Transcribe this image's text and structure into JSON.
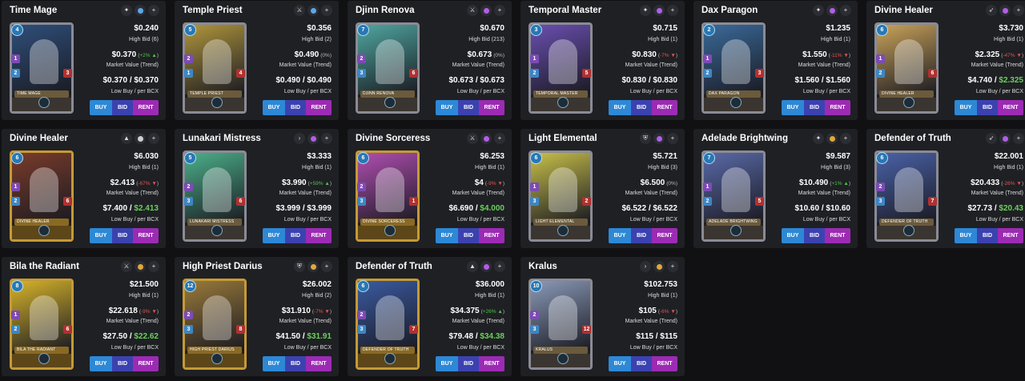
{
  "labels": {
    "high_bid_prefix": "High Bid",
    "market_value": "Market Value (Trend)",
    "low_buy": "Low Buy / per BCX",
    "buy": "BUY",
    "bid": "BID",
    "rent": "RENT"
  },
  "colors": {
    "buy": "#2d88d6",
    "bid": "#3b42b0",
    "rent": "#9c2bb3",
    "positive": "#4fc24a",
    "negative": "#e0554e",
    "silver_frame": "#8b8b95",
    "gold_frame": "#c59a36"
  },
  "cards": [
    {
      "name": "Time Mage",
      "type_icon": "summoner-hex-icon",
      "rarity_color": "#5aa8e6",
      "foil": "regular",
      "element_color": "#2f4f7a",
      "mana": "4",
      "atk": "1",
      "spd": "2",
      "hp": "3",
      "price": "$0.240",
      "high_bid": "High Bid (6)",
      "mv": "$0.370",
      "trend": "+2%",
      "trend_dir": "pos",
      "trend_arrow": "▲",
      "low_buy": "$0.370",
      "low_bcx": "$0.370",
      "bcx_green": false,
      "banner": "TIME MAGE"
    },
    {
      "name": "Temple Priest",
      "type_icon": "sword-icon",
      "rarity_color": "#5aa8e6",
      "foil": "regular",
      "element_color": "#b0963c",
      "mana": "5",
      "atk": "2",
      "spd": "1",
      "hp": "4",
      "price": "$0.356",
      "high_bid": "High Bid (2)",
      "mv": "$0.490",
      "trend": "0%",
      "trend_dir": "neu",
      "trend_arrow": "",
      "low_buy": "$0.490",
      "low_bcx": "$0.490",
      "bcx_green": false,
      "banner": "TEMPLE PRIEST"
    },
    {
      "name": "Djinn Renova",
      "type_icon": "sword-icon",
      "rarity_color": "#b05ee6",
      "foil": "regular",
      "element_color": "#4fa6a0",
      "mana": "7",
      "atk": "2",
      "spd": "3",
      "hp": "6",
      "price": "$0.670",
      "high_bid": "High Bid (213)",
      "mv": "$0.673",
      "trend": "0%",
      "trend_dir": "neu",
      "trend_arrow": "",
      "low_buy": "$0.673",
      "low_bcx": "$0.673",
      "bcx_green": false,
      "banner": "DJINN RENOVA"
    },
    {
      "name": "Temporal Master",
      "type_icon": "summoner-hex-icon",
      "rarity_color": "#b05ee6",
      "foil": "regular",
      "element_color": "#6a4fb0",
      "mana": "3",
      "atk": "1",
      "spd": "2",
      "hp": "5",
      "price": "$0.715",
      "high_bid": "High Bid (1)",
      "mv": "$0.830",
      "trend": "-7%",
      "trend_dir": "neg",
      "trend_arrow": "▼",
      "low_buy": "$0.830",
      "low_bcx": "$0.830",
      "bcx_green": false,
      "banner": "TEMPORAL MASTER"
    },
    {
      "name": "Dax Paragon",
      "type_icon": "summoner-hex-icon",
      "rarity_color": "#b05ee6",
      "foil": "regular",
      "element_color": "#3a6a9a",
      "mana": "2",
      "atk": "1",
      "spd": "2",
      "hp": "3",
      "price": "$1.235",
      "high_bid": "High Bid (1)",
      "mv": "$1.550",
      "trend": "-11%",
      "trend_dir": "neg",
      "trend_arrow": "▼",
      "low_buy": "$1.560",
      "low_bcx": "$1.560",
      "bcx_green": false,
      "banner": "DAX PARAGON"
    },
    {
      "name": "Divine Healer",
      "type_icon": "bow-icon",
      "rarity_color": "#b05ee6",
      "foil": "regular",
      "element_color": "#c9a35a",
      "mana": "6",
      "atk": "1",
      "spd": "2",
      "hp": "6",
      "price": "$3.730",
      "high_bid": "High Bid (1)",
      "mv": "$2.325",
      "trend": "-47%",
      "trend_dir": "neg",
      "trend_arrow": "▼",
      "low_buy": "$4.740",
      "low_bcx": "$2.325",
      "bcx_green": true,
      "banner": "DIVINE HEALER"
    },
    {
      "name": "Divine Healer",
      "type_icon": "magic-icon",
      "rarity_color": "#cfcfcf",
      "foil": "gold",
      "element_color": "#7a3c2a",
      "mana": "6",
      "atk": "1",
      "spd": "2",
      "hp": "6",
      "price": "$6.030",
      "high_bid": "High Bid (1)",
      "mv": "$2.413",
      "trend": "-67%",
      "trend_dir": "neg",
      "trend_arrow": "▼",
      "low_buy": "$7.400",
      "low_bcx": "$2.413",
      "bcx_green": true,
      "banner": "DIVINE HEALER"
    },
    {
      "name": "Lunakari Mistress",
      "type_icon": "chevron-right-icon",
      "rarity_color": "#b05ee6",
      "foil": "regular",
      "element_color": "#4cb08a",
      "mana": "5",
      "atk": "2",
      "spd": "3",
      "hp": "6",
      "price": "$3.333",
      "high_bid": "High Bid (1)",
      "mv": "$3.990",
      "trend": "+59%",
      "trend_dir": "pos",
      "trend_arrow": "▲",
      "low_buy": "$3.999",
      "low_bcx": "$3.999",
      "bcx_green": false,
      "banner": "LUNAKARI MISTRESS"
    },
    {
      "name": "Divine Sorceress",
      "type_icon": "sword-icon",
      "rarity_color": "#b05ee6",
      "foil": "gold",
      "element_color": "#b04fb0",
      "mana": "6",
      "atk": "2",
      "spd": "3",
      "hp": "1",
      "price": "$6.253",
      "high_bid": "High Bid (1)",
      "mv": "$4",
      "trend": "-9%",
      "trend_dir": "neg",
      "trend_arrow": "▼",
      "low_buy": "$6.690",
      "low_bcx": "$4.000",
      "bcx_green": true,
      "banner": "DIVINE SORCERESS"
    },
    {
      "name": "Light Elemental",
      "type_icon": "shield-icon",
      "rarity_color": "#b05ee6",
      "foil": "regular",
      "element_color": "#c8c04a",
      "mana": "6",
      "atk": "1",
      "spd": "3",
      "hp": "2",
      "price": "$5.721",
      "high_bid": "High Bid (3)",
      "mv": "$6.500",
      "trend": "0%",
      "trend_dir": "neu",
      "trend_arrow": "",
      "low_buy": "$6.522",
      "low_bcx": "$6.522",
      "bcx_green": false,
      "banner": "LIGHT ELEMENTAL"
    },
    {
      "name": "Adelade Brightwing",
      "type_icon": "summoner-hex-icon",
      "rarity_color": "#e0a838",
      "foil": "regular",
      "element_color": "#5a6aa8",
      "mana": "7",
      "atk": "1",
      "spd": "2",
      "hp": "5",
      "price": "$9.587",
      "high_bid": "High Bid (3)",
      "mv": "$10.490",
      "trend": "+1%",
      "trend_dir": "pos",
      "trend_arrow": "▲",
      "low_buy": "$10.60",
      "low_bcx": "$10.60",
      "bcx_green": false,
      "banner": "ADELADE BRIGHTWING"
    },
    {
      "name": "Defender of Truth",
      "type_icon": "bow-icon",
      "rarity_color": "#b05ee6",
      "foil": "regular",
      "element_color": "#4a62a8",
      "mana": "6",
      "atk": "2",
      "spd": "3",
      "hp": "7",
      "price": "$22.001",
      "high_bid": "High Bid (1)",
      "mv": "$20.433",
      "trend": "-26%",
      "trend_dir": "neg",
      "trend_arrow": "▼",
      "low_buy": "$27.73",
      "low_bcx": "$20.43",
      "bcx_green": true,
      "banner": "DEFENDER OF TRUTH"
    },
    {
      "name": "Bila the Radiant",
      "type_icon": "sword-icon",
      "rarity_color": "#e0a838",
      "foil": "gold",
      "element_color": "#d6b32a",
      "mana": "8",
      "atk": "1",
      "spd": "2",
      "hp": "6",
      "price": "$21.500",
      "high_bid": "High Bid (1)",
      "mv": "$22.618",
      "trend": "-9%",
      "trend_dir": "neg",
      "trend_arrow": "▼",
      "low_buy": "$27.50",
      "low_bcx": "$22.62",
      "bcx_green": true,
      "banner": "BILA THE RADIANT"
    },
    {
      "name": "High Priest Darius",
      "type_icon": "shield-icon",
      "rarity_color": "#e0a838",
      "foil": "gold",
      "element_color": "#9a7a3a",
      "mana": "12",
      "atk": "2",
      "spd": "3",
      "hp": "8",
      "price": "$26.002",
      "high_bid": "High Bid (2)",
      "mv": "$31.910",
      "trend": "-7%",
      "trend_dir": "neg",
      "trend_arrow": "▼",
      "low_buy": "$41.50",
      "low_bcx": "$31.91",
      "bcx_green": true,
      "banner": "HIGH PRIEST DARIUS"
    },
    {
      "name": "Defender of Truth",
      "type_icon": "magic-icon",
      "rarity_color": "#b05ee6",
      "foil": "gold",
      "element_color": "#3a5aa0",
      "mana": "6",
      "atk": "2",
      "spd": "3",
      "hp": "7",
      "price": "$36.000",
      "high_bid": "High Bid (1)",
      "mv": "$34.375",
      "trend": "+26%",
      "trend_dir": "pos",
      "trend_arrow": "▲",
      "low_buy": "$79.48",
      "low_bcx": "$34.38",
      "bcx_green": true,
      "banner": "DEFENDER OF TRUTH"
    },
    {
      "name": "Kralus",
      "type_icon": "chevron-right-icon",
      "rarity_color": "#e0a838",
      "foil": "regular",
      "element_color": "#8a9ab8",
      "mana": "10",
      "atk": "2",
      "spd": "3",
      "hp": "12",
      "price": "$102.753",
      "high_bid": "High Bid (1)",
      "mv": "$105",
      "trend": "-6%",
      "trend_dir": "neg",
      "trend_arrow": "▼",
      "low_buy": "$115",
      "low_bcx": "$115",
      "bcx_green": false,
      "banner": "KRALUS"
    }
  ]
}
